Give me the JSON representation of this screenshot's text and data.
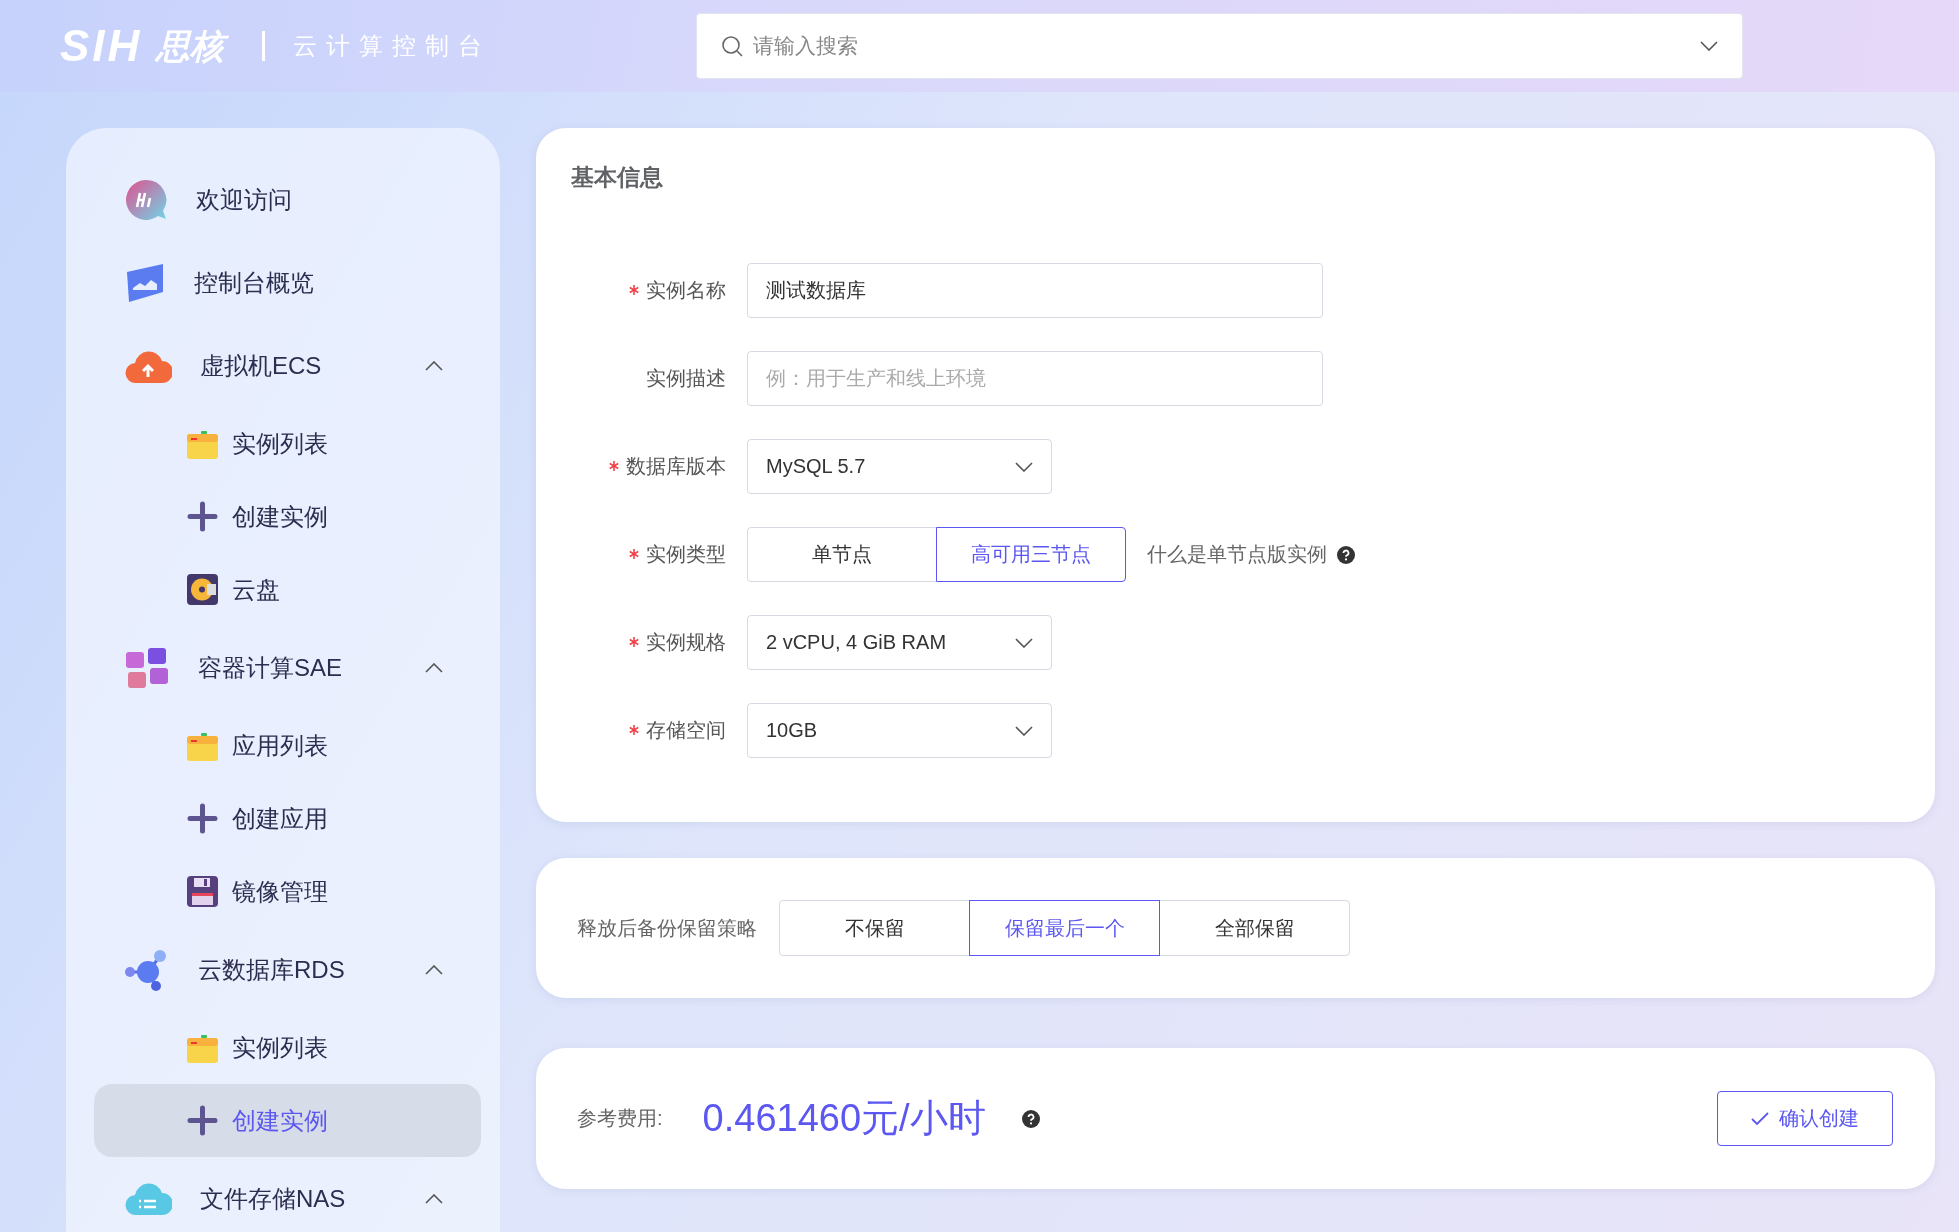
{
  "header": {
    "brand_mark": "SIH",
    "brand_name": "思核",
    "product": "云计算控制台",
    "search": {
      "placeholder": "请输入搜索"
    }
  },
  "sidebar": {
    "items": [
      {
        "label": "欢迎访问",
        "selected": false
      },
      {
        "label": "控制台概览",
        "selected": false
      },
      {
        "label": "虚拟机ECS",
        "selected": false,
        "expanded": true,
        "children": [
          {
            "label": "实例列表",
            "selected": false
          },
          {
            "label": "创建实例",
            "selected": false
          },
          {
            "label": "云盘",
            "selected": false
          }
        ]
      },
      {
        "label": "容器计算SAE",
        "selected": false,
        "expanded": true,
        "children": [
          {
            "label": "应用列表",
            "selected": false
          },
          {
            "label": "创建应用",
            "selected": false
          },
          {
            "label": "镜像管理",
            "selected": false
          }
        ]
      },
      {
        "label": "云数据库RDS",
        "selected": false,
        "expanded": true,
        "children": [
          {
            "label": "实例列表",
            "selected": false
          },
          {
            "label": "创建实例",
            "selected": true
          }
        ]
      },
      {
        "label": "文件存储NAS",
        "selected": false,
        "expanded": true
      }
    ]
  },
  "basic_info": {
    "title": "基本信息",
    "fields": [
      {
        "kind": "input",
        "label": "实例名称",
        "required": true,
        "value": "测试数据库"
      },
      {
        "kind": "input",
        "label": "实例描述",
        "required": false,
        "placeholder": "例：用于生产和线上环境"
      },
      {
        "kind": "select",
        "label": "数据库版本",
        "required": true,
        "value": "MySQL 5.7"
      },
      {
        "kind": "segmented",
        "label": "实例类型",
        "required": true,
        "options": [
          {
            "label": "单节点",
            "selected": false
          },
          {
            "label": "高可用三节点",
            "selected": true
          }
        ],
        "help": "什么是单节点版实例"
      },
      {
        "kind": "select",
        "label": "实例规格",
        "required": true,
        "value": "2 vCPU, 4 GiB RAM"
      },
      {
        "kind": "select",
        "label": "存储空间",
        "required": true,
        "value": "10GB"
      }
    ]
  },
  "backup_policy": {
    "label": "释放后备份保留策略",
    "options": [
      {
        "label": "不保留",
        "selected": false
      },
      {
        "label": "保留最后一个",
        "selected": true
      },
      {
        "label": "全部保留",
        "selected": false
      }
    ]
  },
  "cost": {
    "label": "参考费用:",
    "price": "0.461460元/小时",
    "confirm_button": "确认创建"
  }
}
